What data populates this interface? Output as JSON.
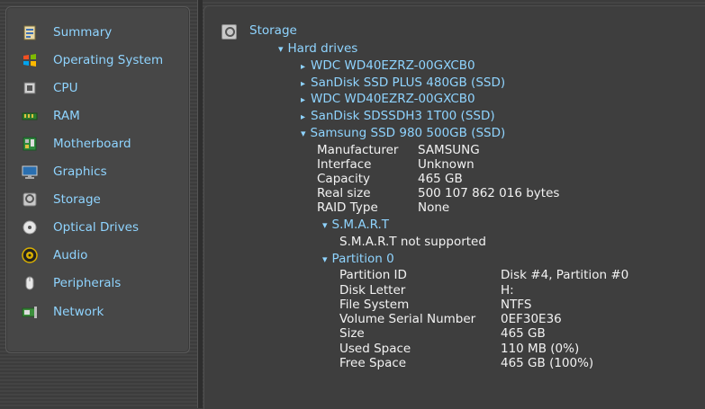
{
  "sidebar": {
    "items": [
      {
        "label": "Summary",
        "icon": "summary-icon"
      },
      {
        "label": "Operating System",
        "icon": "windows-logo-icon"
      },
      {
        "label": "CPU",
        "icon": "cpu-chip-icon"
      },
      {
        "label": "RAM",
        "icon": "ram-module-icon"
      },
      {
        "label": "Motherboard",
        "icon": "motherboard-icon"
      },
      {
        "label": "Graphics",
        "icon": "monitor-icon"
      },
      {
        "label": "Storage",
        "icon": "hard-drive-icon"
      },
      {
        "label": "Optical Drives",
        "icon": "optical-disc-icon"
      },
      {
        "label": "Audio",
        "icon": "speaker-icon"
      },
      {
        "label": "Peripherals",
        "icon": "mouse-icon"
      },
      {
        "label": "Network",
        "icon": "network-card-icon"
      }
    ]
  },
  "main": {
    "root_label": "Storage",
    "hard_drives_label": "Hard drives",
    "drives": [
      "WDC WD40EZRZ-00GXCB0",
      "SanDisk SSD PLUS 480GB (SSD)",
      "WDC WD40EZRZ-00GXCB0",
      "SanDisk SDSSDH3 1T00 (SSD)",
      "Samsung SSD 980 500GB (SSD)"
    ],
    "selected_drive": {
      "properties": [
        {
          "key": "Manufacturer",
          "value": "SAMSUNG"
        },
        {
          "key": "Interface",
          "value": "Unknown"
        },
        {
          "key": "Capacity",
          "value": "465 GB"
        },
        {
          "key": "Real size",
          "value": "500 107 862 016 bytes"
        },
        {
          "key": "RAID Type",
          "value": "None"
        }
      ],
      "smart_label": "S.M.A.R.T",
      "smart_status": "S.M.A.R.T not supported",
      "partition_label": "Partition 0",
      "partition_properties": [
        {
          "key": "Partition ID",
          "value": "Disk #4, Partition #0"
        },
        {
          "key": "Disk Letter",
          "value": "H:"
        },
        {
          "key": "File System",
          "value": "NTFS"
        },
        {
          "key": "Volume Serial Number",
          "value": "0EF30E36"
        },
        {
          "key": "Size",
          "value": "465 GB"
        },
        {
          "key": "Used Space",
          "value": "110 MB (0%)"
        },
        {
          "key": "Free Space",
          "value": "465 GB (100%)"
        }
      ]
    }
  },
  "colors": {
    "link": "#8fd4ff",
    "text": "#f2f2f2",
    "background": "#3e3e3e"
  }
}
